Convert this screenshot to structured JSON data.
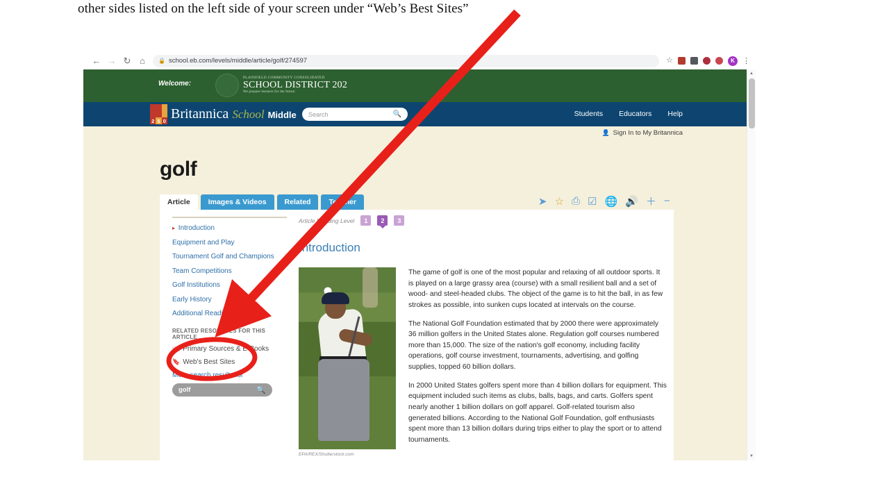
{
  "slide": {
    "caption": "other sides listed on the left side of your screen under “Web’s Best Sites”"
  },
  "browser": {
    "back_icon": "←",
    "forward_icon": "→",
    "reload_icon": "↻",
    "home_icon": "⌂",
    "lock_icon": "🔒",
    "url": "school.eb.com/levels/middle/article/golf/274597",
    "bookmark_icon": "☆",
    "extensions": [
      "extension-icon-1",
      "extension-icon-2",
      "extension-icon-3",
      "extension-icon-4"
    ],
    "profile_initial": "K",
    "menu_icon": "⋮"
  },
  "district_banner": {
    "welcome_label": "Welcome:",
    "line1": "PLAINFIELD COMMUNITY CONSOLIDATED",
    "line2": "SCHOOL DISTRICT 202",
    "line3": "We prepare learners for the future."
  },
  "brand": {
    "logo_number": "250",
    "name": "Britannica",
    "suffix": "School",
    "level": "Middle"
  },
  "search": {
    "placeholder": "Search",
    "icon": "search-icon"
  },
  "topnav": {
    "items": [
      "Students",
      "Educators",
      "Help"
    ]
  },
  "account": {
    "person_icon": "👤",
    "signin_label": "Sign In to My Britannica"
  },
  "page": {
    "title": "golf"
  },
  "tabs": [
    {
      "label": "Article",
      "active": true
    },
    {
      "label": "Images & Videos",
      "active": false
    },
    {
      "label": "Related",
      "active": false
    },
    {
      "label": "Teacher",
      "active": false
    }
  ],
  "toolbar": {
    "icons": [
      {
        "name": "share-icon",
        "glyph": "➦"
      },
      {
        "name": "favorite-star-icon",
        "glyph": "☆"
      },
      {
        "name": "print-icon",
        "glyph": "⎙"
      },
      {
        "name": "cite-checkbox-icon",
        "glyph": "☑"
      },
      {
        "name": "translate-globe-icon",
        "glyph": "ἱ0"
      },
      {
        "name": "listen-speaker-icon",
        "glyph": "🔊"
      },
      {
        "name": "zoom-in-icon",
        "glyph": "＋"
      },
      {
        "name": "zoom-out-icon",
        "glyph": "−"
      }
    ]
  },
  "sidebar": {
    "sections": [
      "Introduction",
      "Equipment and Play",
      "Tournament Golf and Champions",
      "Team Competitions",
      "Golf Institutions",
      "Early History",
      "Additional Reading"
    ],
    "current_section": "Introduction",
    "resources_heading": "RELATED RESOURCES FOR THIS ARTICLE",
    "resources": [
      {
        "label": "Primary Sources & E-Books",
        "icon": "book-icon"
      },
      {
        "label": "Web's Best Sites",
        "icon": "bookmark-icon"
      }
    ],
    "more_results_label": "More search results for",
    "search_value": "golf",
    "search_icon": "search-icon"
  },
  "article": {
    "reading_level_label": "Article Reading Level",
    "reading_levels": [
      "1",
      "2",
      "3"
    ],
    "selected_level": "2",
    "section_title": "Introduction",
    "image_credit": "EPA/REX/Shutterstock.com",
    "paragraphs": [
      "The game of golf is one of the most popular and relaxing of all outdoor sports. It is played on a large grassy area (course) with a small resilient ball and a set of wood- and steel-headed clubs. The object of the game is to hit the ball, in as few strokes as possible, into sunken cups located at intervals on the course.",
      "The National Golf Foundation estimated that by 2000 there were approximately 36 million golfers in the United States alone. Regulation golf courses numbered more than 15,000. The size of the nation's golf economy, including facility operations, golf course investment, tournaments, advertising, and golfing supplies, topped 60 billion dollars.",
      "In 2000 United States golfers spent more than 4 billion dollars for equipment. This equipment included such items as clubs, balls, bags, and carts. Golfers spent nearly another 1 billion dollars on golf apparel. Golf-related tourism also generated billions. According to the National Golf Foundation, golf enthusiasts spent more than 13 billion dollars during trips either to play the sport or to attend tournaments."
    ]
  },
  "scrollbar": {
    "up_icon": "▲",
    "down_icon": "▼"
  },
  "annotations": {
    "arrow_color": "#e8201a",
    "circle_color": "#e8201a",
    "arrow_target": "Web's Best Sites",
    "circle_target": "Web's Best Sites"
  },
  "colors": {
    "district_green": "#2d6030",
    "brand_navy": "#0d4570",
    "page_cream": "#f5f0dc",
    "tab_blue": "#3a9ad0",
    "link_blue": "#2f6fa8",
    "annotation_red": "#e8201a"
  }
}
